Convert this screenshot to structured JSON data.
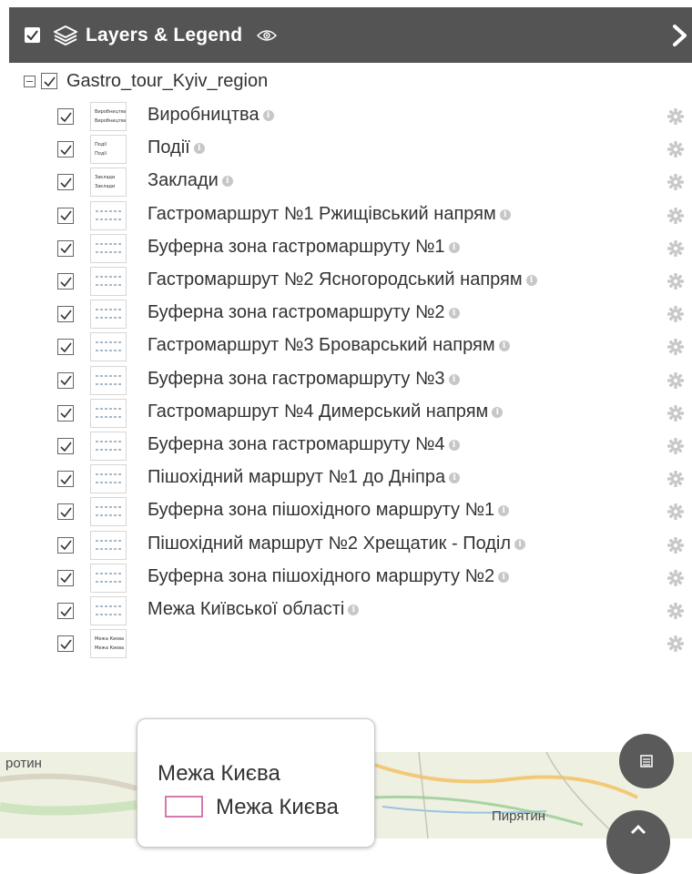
{
  "panel": {
    "title": "Layers & Legend",
    "icons": {
      "layers": "layers-icon",
      "visibility": "eye-icon",
      "collapse": "chevron-right-icon"
    }
  },
  "group": {
    "name": "Gastro_tour_Kyiv_region",
    "checked": true,
    "expanded": true
  },
  "layers": [
    {
      "label": "Виробництва",
      "thumb": [
        "Виробництва",
        "Виробництва"
      ]
    },
    {
      "label": "Події",
      "thumb": [
        "Події",
        "Події"
      ]
    },
    {
      "label": "Заклади",
      "thumb": [
        "Заклади",
        "Заклади"
      ]
    },
    {
      "label": "Гастромаршрут №1 Ржищівський напрям"
    },
    {
      "label": "Буферна зона гастромаршруту №1"
    },
    {
      "label": "Гастромаршрут №2 Ясногородський напрям"
    },
    {
      "label": "Буферна зона гастромаршруту №2"
    },
    {
      "label": "Гастромаршрут №3 Броварський напрям"
    },
    {
      "label": "Буферна зона гастромаршруту №3"
    },
    {
      "label": "Гастромаршрут №4 Димерський напрям"
    },
    {
      "label": "Буферна зона гастромаршруту №4"
    },
    {
      "label": "Пішохідний маршрут №1 до Дніпра"
    },
    {
      "label": "Буферна зона пішохідного маршруту №1"
    },
    {
      "label": "Пішохідний маршрут №2 Хрещатик - Поділ"
    },
    {
      "label": "Буферна зона пішохідного маршруту №2"
    },
    {
      "label": "Межа Київської області"
    },
    {
      "label": "",
      "thumb": [
        "Межа Києва",
        "Межа Києва"
      ]
    }
  ],
  "legend_popup": {
    "title": "Межа Києва",
    "item": "Межа Києва",
    "swatch_color": "#d47ab0"
  },
  "map": {
    "labels": [
      "ротин",
      "Пирятин"
    ]
  },
  "colors": {
    "header_bg": "#545454",
    "gear": "#c8c8c8",
    "info": "#c7c7c7"
  }
}
